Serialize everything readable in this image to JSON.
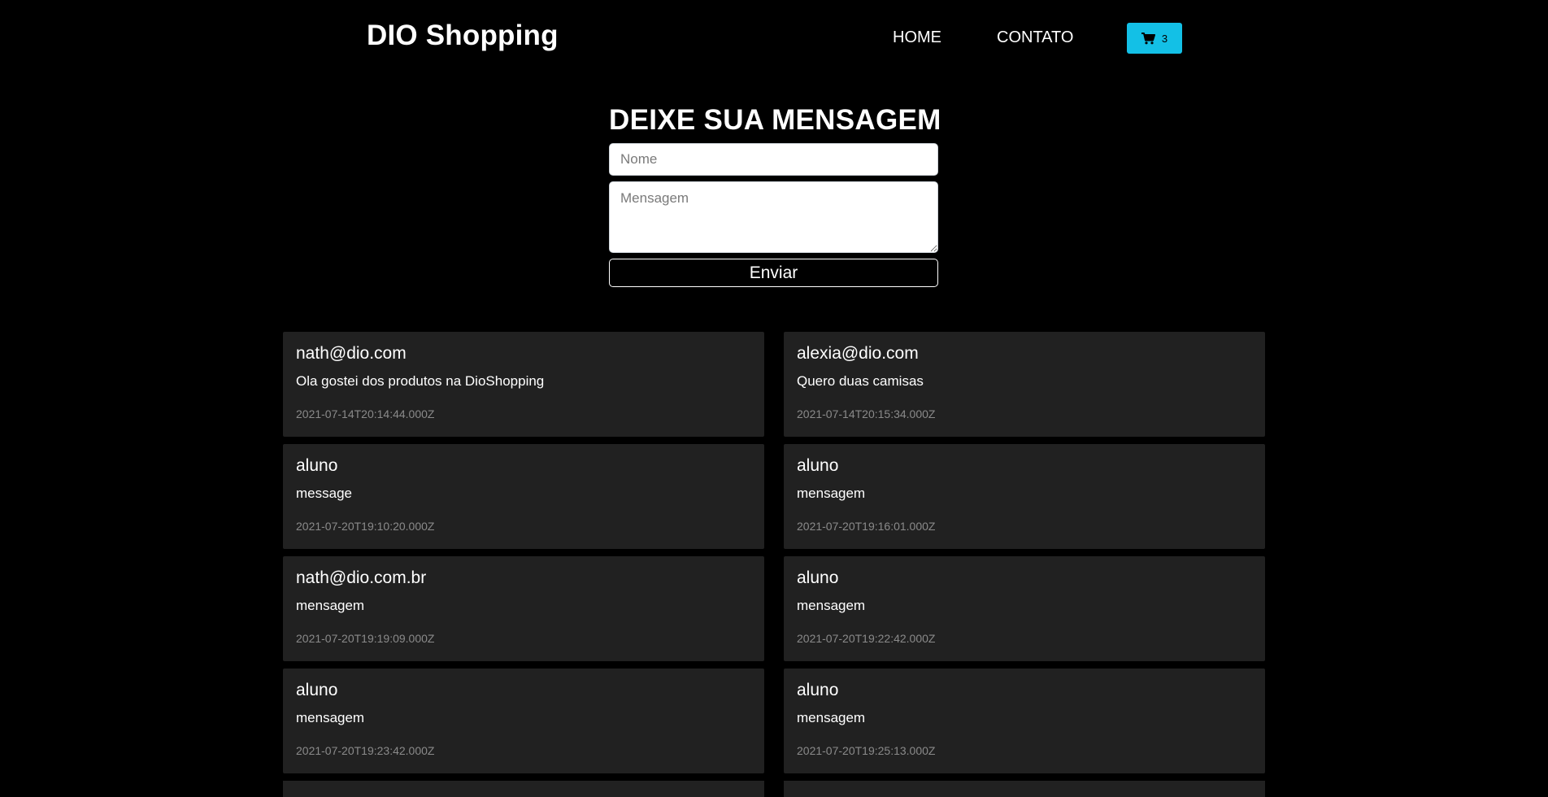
{
  "header": {
    "brand": "DIO Shopping",
    "nav": {
      "home": "HOME",
      "contato": "CONTATO"
    },
    "cart": {
      "count": "3",
      "icon": "cart-icon",
      "color": "#13c0e6"
    }
  },
  "form": {
    "title": "DEIXE SUA MENSAGEM",
    "name_placeholder": "Nome",
    "message_placeholder": "Mensagem",
    "submit_label": "Enviar"
  },
  "messages": [
    {
      "email": "nath@dio.com",
      "message": "Ola gostei dos produtos na DioShopping",
      "created_at": "2021-07-14T20:14:44.000Z"
    },
    {
      "email": "alexia@dio.com",
      "message": "Quero duas camisas",
      "created_at": "2021-07-14T20:15:34.000Z"
    },
    {
      "email": "aluno",
      "message": "message",
      "created_at": "2021-07-20T19:10:20.000Z"
    },
    {
      "email": "aluno",
      "message": "mensagem",
      "created_at": "2021-07-20T19:16:01.000Z"
    },
    {
      "email": "nath@dio.com.br",
      "message": "mensagem",
      "created_at": "2021-07-20T19:19:09.000Z"
    },
    {
      "email": "aluno",
      "message": "mensagem",
      "created_at": "2021-07-20T19:22:42.000Z"
    },
    {
      "email": "aluno",
      "message": "mensagem",
      "created_at": "2021-07-20T19:23:42.000Z"
    },
    {
      "email": "aluno",
      "message": "mensagem",
      "created_at": "2021-07-20T19:25:13.000Z"
    }
  ]
}
